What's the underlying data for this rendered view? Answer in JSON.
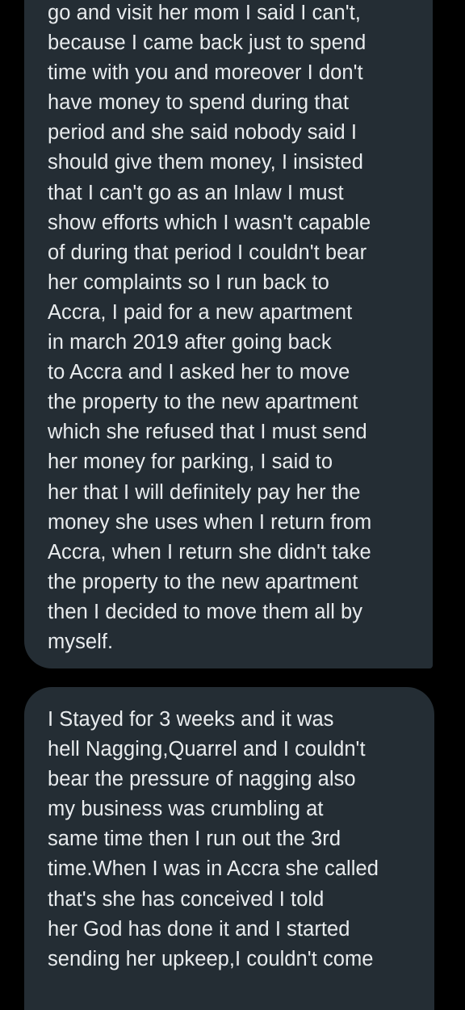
{
  "conversation": {
    "messages": [
      {
        "lines": [
          "go and visit her mom I said I can't,",
          "because I came back just to spend",
          "time with you and moreover I don't",
          "have money to spend during that",
          "period and she said nobody said I",
          "should give them money, I insisted",
          "that I can't go as an Inlaw I must",
          "show efforts which I wasn't capable",
          "of during that period I couldn't bear",
          "her complaints so I run back to",
          "Accra, I paid for a new apartment",
          "in march 2019 after going back",
          "to Accra and I asked her to move",
          "the property to the new apartment",
          "which she refused that I must send",
          "her money for parking, I said to",
          "her that I will definitely pay her the",
          "money she uses when I return from",
          "Accra, when I return she didn't take",
          "the property to the new apartment",
          "then I decided to move them all by",
          "myself."
        ]
      },
      {
        "lines": [
          "I Stayed for 3 weeks and it was",
          "hell Nagging,Quarrel and I couldn't",
          "bear the pressure of nagging also",
          "my business was crumbling at",
          "same time then I run out the 3rd",
          "time.When I was in Accra she called",
          "that's she has conceived I told",
          "her God has done it and I started",
          "sending her upkeep,I couldn't come"
        ]
      }
    ]
  }
}
